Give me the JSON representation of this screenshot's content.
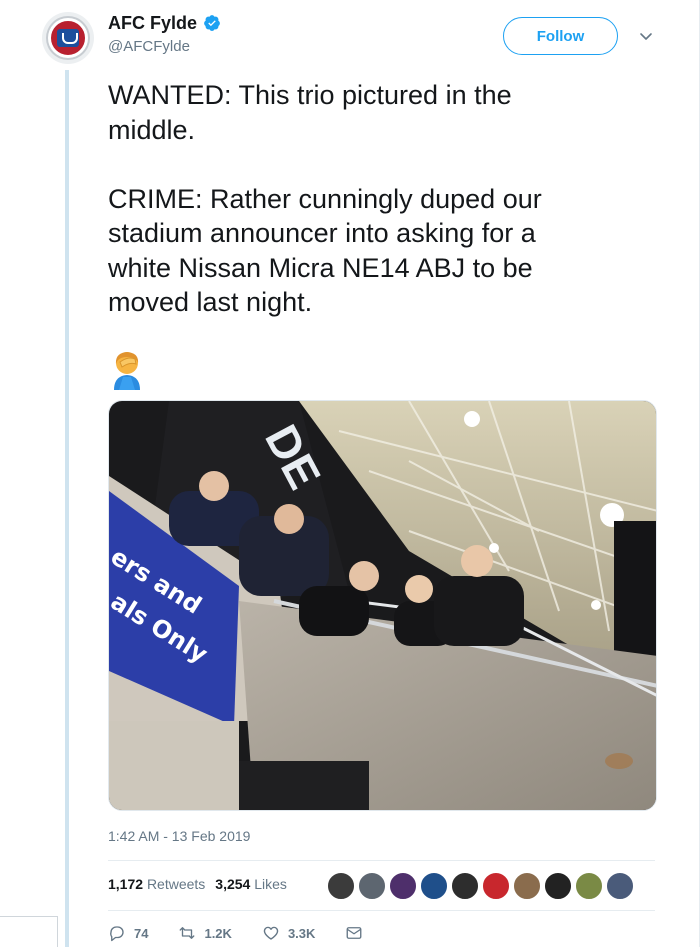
{
  "account": {
    "display_name": "AFC Fylde",
    "handle": "@AFCFylde",
    "verified": true
  },
  "header": {
    "follow_label": "Follow"
  },
  "tweet": {
    "text": "WANTED: This trio pictured in the\nmiddle.\n\nCRIME: Rather cunningly duped our\nstadium announcer into asking for a\nwhite Nissan Micra NE14 ABJ to be\nmoved last night.",
    "emoji": "facepalm",
    "timestamp": "1:42 AM - 13 Feb 2019",
    "photo": {
      "banner_text_line1": "ers and",
      "banner_text_line2": "als Only",
      "stand_sign": "DE"
    }
  },
  "stats": {
    "retweets_count": "1,172",
    "retweets_label": "Retweets",
    "likes_count": "3,254",
    "likes_label": "Likes"
  },
  "actions": {
    "replies": "74",
    "retweets": "1.2K",
    "likes": "3.3K"
  },
  "colors": {
    "accent": "#1da1f2",
    "muted": "#657786",
    "text": "#14171a",
    "brand_red": "#b8202f"
  }
}
